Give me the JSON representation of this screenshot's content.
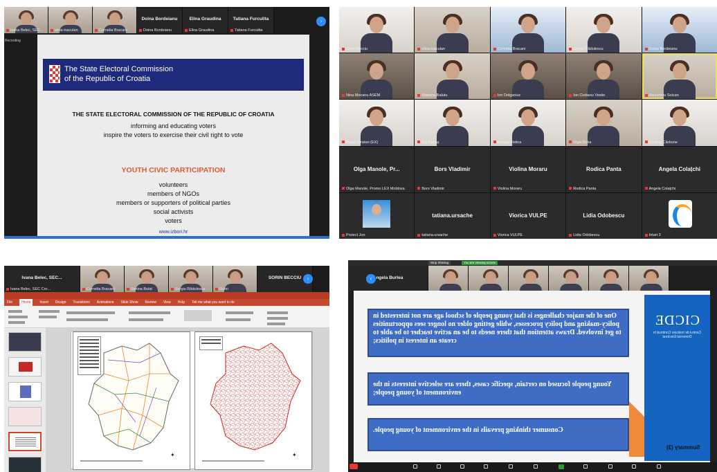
{
  "q1": {
    "strip": {
      "tiles": [
        {
          "label": "Ivana Belec, SEC..."
        },
        {
          "label": "elina inaculan"
        },
        {
          "label": "Cornelia Bracani"
        }
      ],
      "names": [
        "Doina Bordeianu",
        "Elina Graudina",
        "Tatiana Furculita"
      ],
      "name_labels": [
        "Doina Bordeianu",
        "Elina Graudina",
        "Tatiana Furculita"
      ],
      "next_icon": "chevron-right-icon"
    },
    "side_text": "Recording",
    "slide": {
      "banner_line1": "The State Electoral Commission",
      "banner_line2": "of the Republic of Croatia",
      "heading": "THE STATE ELECTORAL COMMISSION OF THE REPUBLIC OF CROATIA",
      "line1": "informing and educating voters",
      "line2": "inspire the voters to exercise their civil right to vote",
      "red_heading": "YOUTH CIVIC PARTICIPATION",
      "items": [
        "volunteers",
        "members of NGOs",
        "members or supporters of political parties",
        "social activists",
        "voters"
      ],
      "url": "www.izbori.hr"
    }
  },
  "q2": {
    "cells": [
      {
        "label": "Sorin Becciu",
        "name": ""
      },
      {
        "label": "elina inaculan",
        "name": ""
      },
      {
        "label": "Cornelia Bracani",
        "name": ""
      },
      {
        "label": "Sergiu Rădulescu",
        "name": ""
      },
      {
        "label": "Doina Bordeianu",
        "name": ""
      },
      {
        "label": "Nina Mocanu ASEM",
        "name": ""
      },
      {
        "label": "Mariana Balutu",
        "name": ""
      },
      {
        "label": "Ion Dolganiuc",
        "name": ""
      },
      {
        "label": "Ion Ciobanu Vestie",
        "name": ""
      },
      {
        "label": "Alexandru Solcan",
        "name": ""
      },
      {
        "label": "Diana Stratan (EX)",
        "name": ""
      },
      {
        "label": "Ina Patraș",
        "name": ""
      },
      {
        "label": "Natalia Fistica",
        "name": ""
      },
      {
        "label": "Olga Doba",
        "name": ""
      },
      {
        "label": "Cristina Cărbune",
        "name": ""
      },
      {
        "label": "Olga Manole, Promo LEX Moldova",
        "name": "Olga Manole, Pr..."
      },
      {
        "label": "Bors Vladimir",
        "name": "Bors Vladimir"
      },
      {
        "label": "Violina Moraru",
        "name": "Violina Moraru"
      },
      {
        "label": "Rodica Panta",
        "name": "Rodica Panta"
      },
      {
        "label": "Angela Colațchi",
        "name": "Angela Colațchi"
      },
      {
        "label": "Proiect Jon",
        "name": ""
      },
      {
        "label": "tatiana.ursache",
        "name": "tatiana.ursache"
      },
      {
        "label": "Viorica VULPE",
        "name": "Viorica VULPE"
      },
      {
        "label": "Lidia Odobescu",
        "name": "Lidia Odobescu"
      },
      {
        "label": "Intart 3",
        "name": ""
      }
    ]
  },
  "q3": {
    "strip": {
      "names": [
        "Ivana Belec, SEC...",
        "SORIN BECCIU"
      ],
      "tile_labels": [
        "Ivana Belec, SEC Cro...",
        "Cornelia Bracani",
        "Simina Bulat",
        "Sergiu Rădulescu",
        "Rufei"
      ],
      "next_icon": "chevron-right-icon"
    },
    "tabs": [
      "File",
      "Home",
      "Insert",
      "Design",
      "Transitions",
      "Animations",
      "Slide Show",
      "Review",
      "View",
      "Help",
      "Tell me what you want to do"
    ]
  },
  "q4": {
    "top_left": "Stop Sharing",
    "top_right": "You are viewing screen",
    "strip_name": "Angela Burlea",
    "back_icon": "chevron-left-icon",
    "slide": {
      "box1": "One of the major challenges is that young people of school age are not interested in policy-making and policy processes, while getting older no longer sees opportunities to get involved. Draws attention that there needs to be an active teacher to be able to create an interest in politics;",
      "box2": "Young people focused on certain, specific cases, there are selective interests in the environment of young people;",
      "box3": "Consumer thinking prevails in the environment of young people.",
      "logo_title": "CICDE",
      "logo_sub": "Centrul de Instruire Continuă în Domeniul Electoral",
      "summary": "Summary (3)"
    }
  }
}
